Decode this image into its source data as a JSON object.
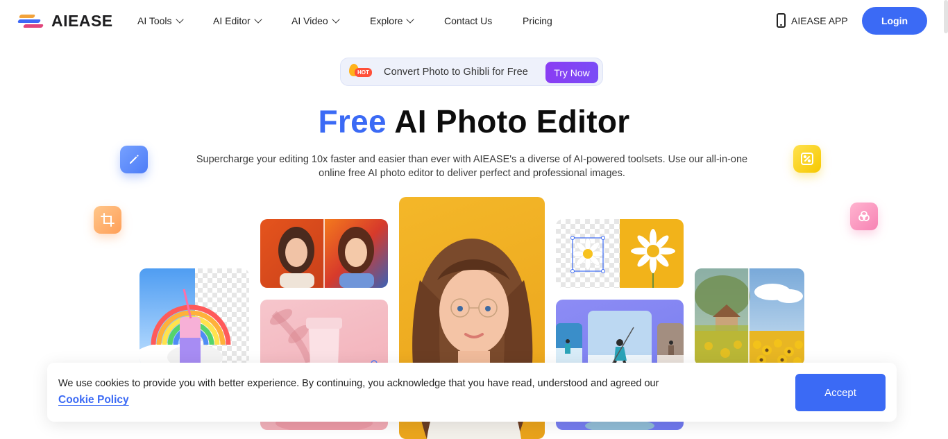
{
  "header": {
    "brand": "AIEASE",
    "nav": [
      {
        "label": "AI Tools",
        "dropdown": true
      },
      {
        "label": "AI Editor",
        "dropdown": true
      },
      {
        "label": "AI Video",
        "dropdown": true
      },
      {
        "label": "Explore",
        "dropdown": true
      },
      {
        "label": "Contact Us",
        "dropdown": false
      },
      {
        "label": "Pricing",
        "dropdown": false
      }
    ],
    "app_label": "AIEASE APP",
    "login_label": "Login"
  },
  "promo": {
    "badge": "HOT",
    "text": "Convert Photo to Ghibli for Free",
    "cta": "Try Now"
  },
  "hero": {
    "title_accent": "Free",
    "title_rest": " AI Photo Editor",
    "subtitle": "Supercharge your editing 10x faster and easier than ever with AIEASE's a diverse of AI-powered toolsets. Use our all-in-one online free AI photo editor to deliver perfect and professional images."
  },
  "floating_icons": [
    "pencil-icon",
    "crop-icon",
    "ai-sparkle-icon",
    "overlap-circles-icon"
  ],
  "gallery": [
    "rainbow-drink-background-removal",
    "portrait-to-painting",
    "pink-cosmetic-tube",
    "woman-portrait-main",
    "daisy-cutout",
    "skier-image-extend",
    "cottage-sunflower-enhance"
  ],
  "cookie": {
    "text": "We use cookies to provide you with better experience. By continuing, you acknowledge that you have read, understood and agreed our",
    "link_label": "Cookie Policy",
    "accept_label": "Accept"
  },
  "colors": {
    "brand_blue": "#3b6af5",
    "purple_cta": "#8a3df3",
    "hot_red": "#ff4f39"
  }
}
